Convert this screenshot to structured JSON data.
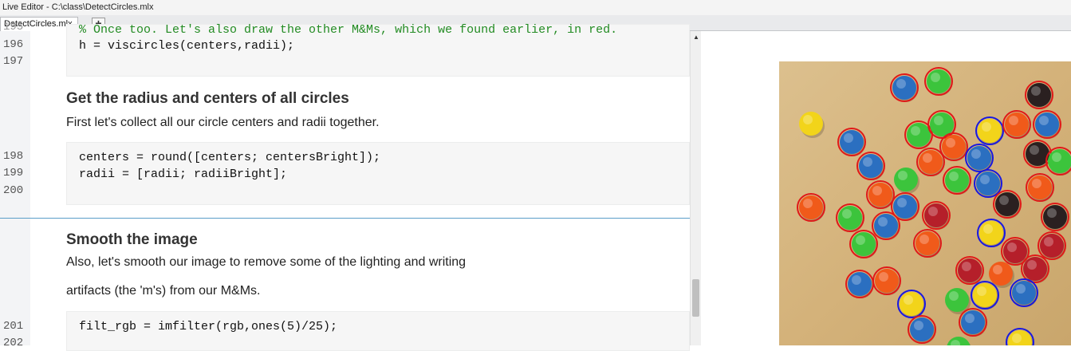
{
  "window": {
    "title": "Live Editor - C:\\class\\DetectCircles.mlx"
  },
  "tabs": [
    {
      "label": "DetectCircles.mlx"
    }
  ],
  "tab_add": "+",
  "editor": {
    "line_numbers": [
      "196",
      "197",
      "198",
      "199",
      "200",
      "201",
      "202"
    ],
    "partial_top_line": "% Once too. Let's also draw the other M&Ms, which we found earlier, in red.",
    "code1": [
      "h = viscircles(centers,radii);"
    ],
    "section1": {
      "heading": "Get the radius and centers of all circles",
      "text": "First let's collect all our circle centers and radii together."
    },
    "code2": [
      "centers = round([centers; centersBright]);",
      "radii = [radii; radiiBright];"
    ],
    "section2": {
      "heading": "Smooth the image",
      "text1": "Also, let's smooth our image to remove some of the lighting and writing",
      "text2": "artifacts (the 'm's) from our M&Ms."
    },
    "code3": [
      "filt_rgb = imfilter(rgb,ones(5)/25);"
    ]
  },
  "figure": {
    "image_subject": "M&M candies on a wooden table with detected circles outlined in red and blue",
    "colors": {
      "red_circle": "#e01818",
      "blue_circle": "#1818e0",
      "wood": "#d8b885"
    }
  }
}
